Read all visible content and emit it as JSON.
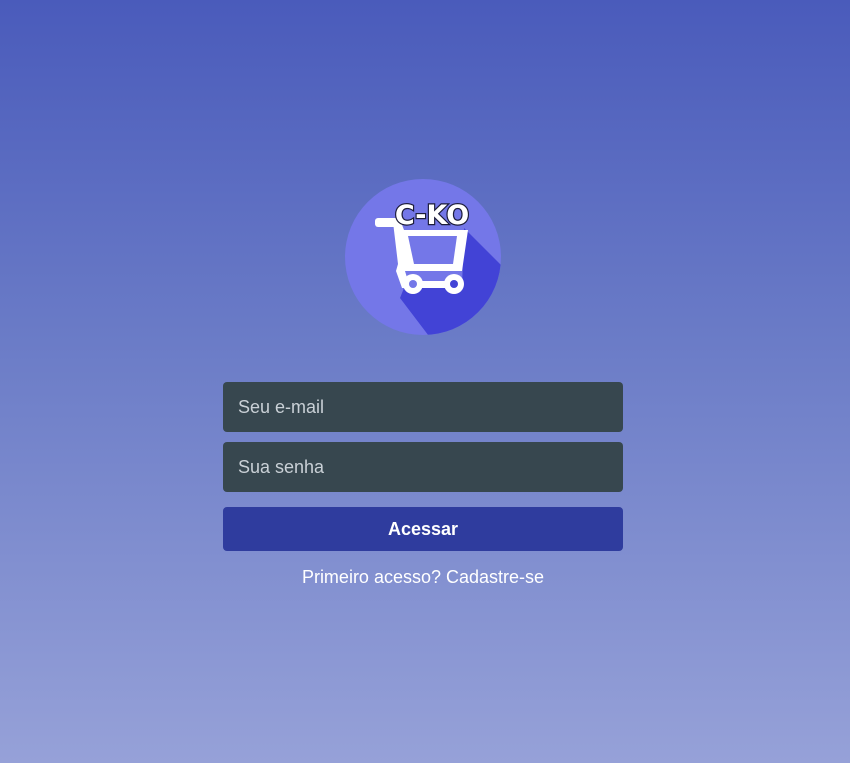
{
  "logo": {
    "text": "C-KO",
    "icon": "shopping-cart-icon",
    "colors": {
      "circle": "#7477e8",
      "shadow": "#4243d6",
      "cart": "#ffffff"
    }
  },
  "login_form": {
    "email_placeholder": "Seu e-mail",
    "password_placeholder": "Sua senha",
    "submit_label": "Acessar",
    "signup_link": "Primeiro acesso? Cadastre-se"
  },
  "colors": {
    "background_top": "#4a5bbb",
    "background_bottom": "#96a1d8",
    "input_background": "#37474f",
    "button_background": "#2f3c9e"
  }
}
